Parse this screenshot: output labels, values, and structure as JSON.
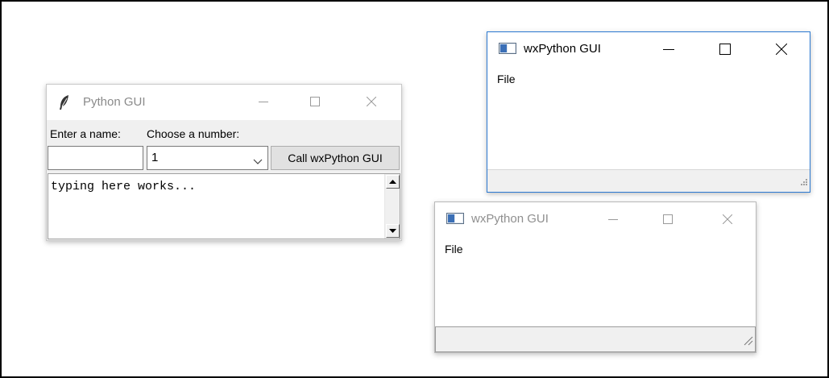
{
  "tk_window": {
    "title": "Python GUI",
    "icon": "feather-icon",
    "name_label": "Enter a name:",
    "number_label": "Choose a number:",
    "name_value": "",
    "number_value": "1",
    "button_label": "Call wxPython GUI",
    "text_content": "typing here works..."
  },
  "wx_window_front": {
    "title": "wxPython GUI",
    "menu": [
      "File"
    ],
    "state": "active"
  },
  "wx_window_back": {
    "title": "wxPython GUI",
    "menu": [
      "File"
    ],
    "state": "inactive"
  },
  "colors": {
    "active_border": "#2b79d1",
    "inactive_title_text": "#8f8f8f",
    "tk_body_bg": "#f0f0f0"
  }
}
